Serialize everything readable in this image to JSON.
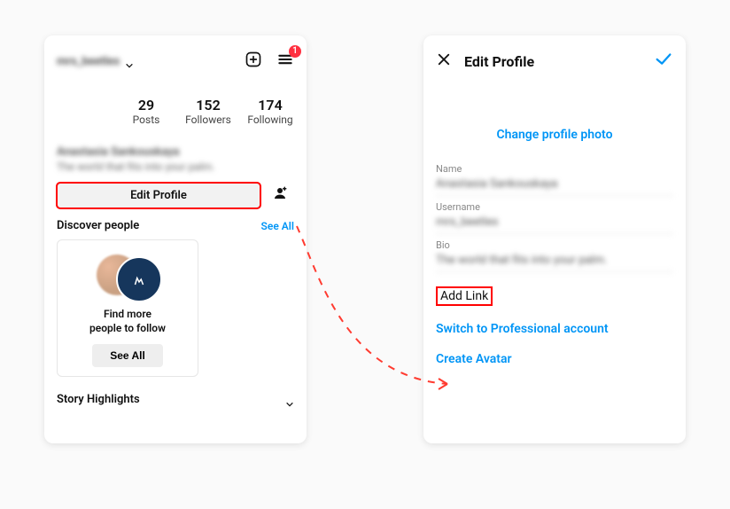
{
  "left": {
    "header": {
      "username_dropdown_value": "mrs_beetles",
      "notification_count": "1"
    },
    "stats": {
      "posts": {
        "value": "29",
        "label": "Posts"
      },
      "followers": {
        "value": "152",
        "label": "Followers"
      },
      "following": {
        "value": "174",
        "label": "Following"
      }
    },
    "bio": {
      "name": "Anastasia Sankouskaya",
      "line": "The world that fits into your palm."
    },
    "edit_profile_label": "Edit Profile",
    "discover": {
      "title": "Discover people",
      "see_all": "See All",
      "card_text": "Find more\npeople to follow",
      "card_button": "See All"
    },
    "story_highlights_label": "Story Highlights"
  },
  "right": {
    "title": "Edit Profile",
    "change_photo": "Change profile photo",
    "fields": {
      "name": {
        "label": "Name",
        "value": "Anastasia Sankouskaya"
      },
      "username": {
        "label": "Username",
        "value": "mrs_beetles"
      },
      "bio": {
        "label": "Bio",
        "value": "The world that fits into your palm."
      }
    },
    "add_link": "Add Link",
    "switch_pro": "Switch to Professional account",
    "create_avatar": "Create Avatar"
  }
}
